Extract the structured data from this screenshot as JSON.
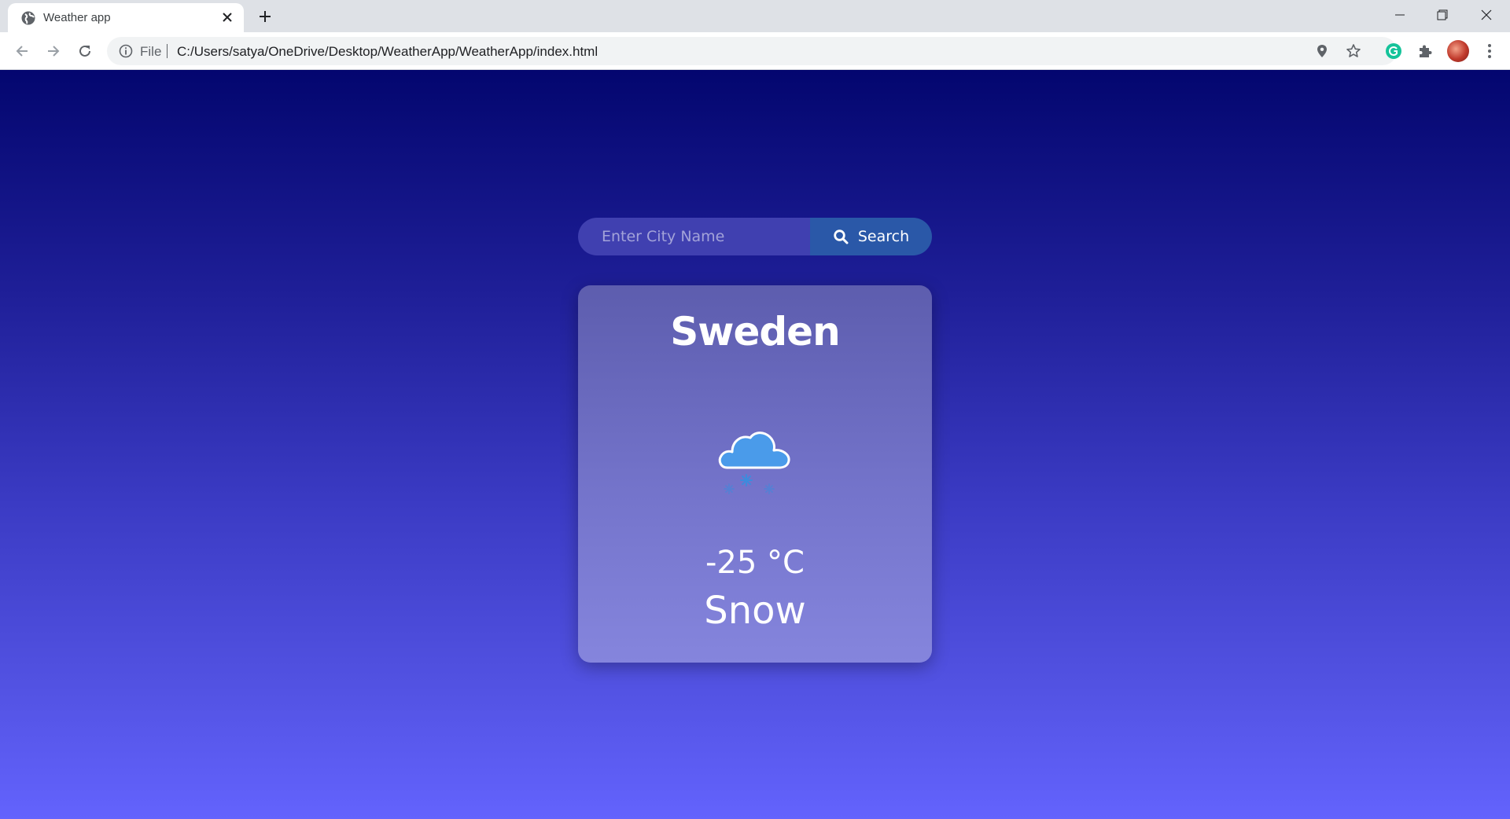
{
  "browser": {
    "tab_title": "Weather app",
    "address_scheme": "File",
    "address_url": "C:/Users/satya/OneDrive/Desktop/WeatherApp/WeatherApp/index.html"
  },
  "search": {
    "placeholder": "Enter City Name",
    "value": "",
    "button_label": "Search"
  },
  "weather": {
    "city": "Sweden",
    "temperature": "-25 °C",
    "condition": "Snow",
    "icon": "snow-cloud-icon"
  },
  "colors": {
    "background_top": "#03066f",
    "background_bottom": "#6363fd",
    "search_button": "#2a58a8",
    "icon_blue": "#4a9bea"
  }
}
